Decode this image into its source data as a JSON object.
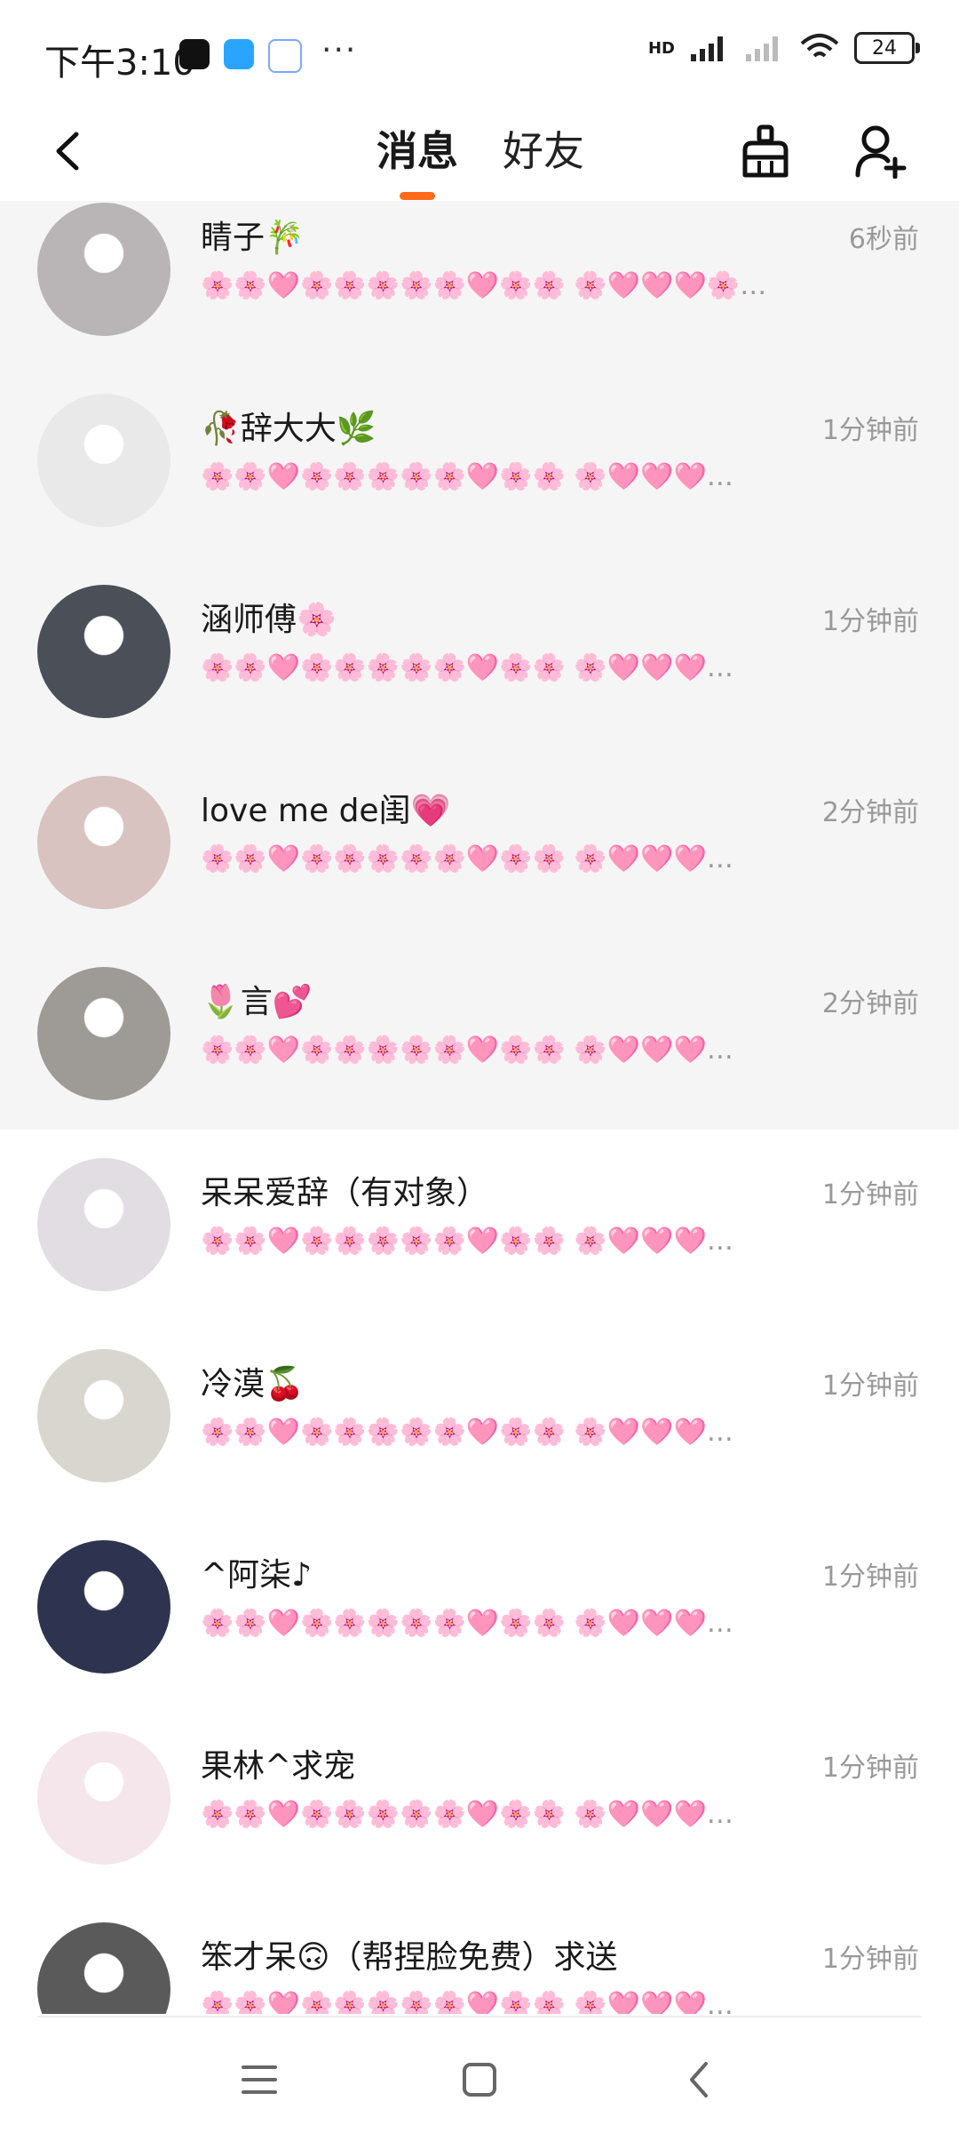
{
  "status_bar": {
    "time": "下午3:10",
    "more_dots": "···",
    "network_label": "HD",
    "battery": "24"
  },
  "nav": {
    "tab_messages": "消息",
    "tab_friends": "好友",
    "accent": "#ff6a1a"
  },
  "messages": [
    {
      "name": "睛子🎋",
      "time": "6秒前",
      "preview": "🌸🌸🩷🌸🌸🌸🌸🌸🩷🌸🌸 🌸🩷🩷🩷🌸…",
      "pinned": true,
      "avatar_color": "#b9b4b6"
    },
    {
      "name": "🥀辞大大🌿",
      "time": "1分钟前",
      "preview": "🌸🌸🩷🌸🌸🌸🌸🌸🩷🌸🌸 🌸🩷🩷🩷…",
      "pinned": true,
      "avatar_color": "#e9e9e9"
    },
    {
      "name": "涵师傅🌸",
      "time": "1分钟前",
      "preview": "🌸🌸🩷🌸🌸🌸🌸🌸🩷🌸🌸 🌸🩷🩷🩷…",
      "pinned": true,
      "avatar_color": "#4b4f57"
    },
    {
      "name": "love me de闺💗",
      "time": "2分钟前",
      "preview": "🌸🌸🩷🌸🌸🌸🌸🌸🩷🌸🌸 🌸🩷🩷🩷…",
      "pinned": true,
      "avatar_color": "#d8c3c0"
    },
    {
      "name": "🌷言💕",
      "time": "2分钟前",
      "preview": "🌸🌸🩷🌸🌸🌸🌸🌸🩷🌸🌸 🌸🩷🩷🩷…",
      "pinned": true,
      "avatar_color": "#9e9a96"
    },
    {
      "name": "呆呆爱辞（有对象）",
      "time": "1分钟前",
      "preview": "🌸🌸🩷🌸🌸🌸🌸🌸🩷🌸🌸 🌸🩷🩷🩷…",
      "pinned": false,
      "avatar_color": "#e2dde3"
    },
    {
      "name": "冷漠🍒",
      "time": "1分钟前",
      "preview": "🌸🌸🩷🌸🌸🌸🌸🌸🩷🌸🌸 🌸🩷🩷🩷…",
      "pinned": false,
      "avatar_color": "#d9d6d0"
    },
    {
      "name": "^阿柒♪",
      "time": "1分钟前",
      "preview": "🌸🌸🩷🌸🌸🌸🌸🌸🩷🌸🌸 🌸🩷🩷🩷…",
      "pinned": false,
      "avatar_color": "#2e3350"
    },
    {
      "name": "果林^求宠",
      "time": "1分钟前",
      "preview": "🌸🌸🩷🌸🌸🌸🌸🌸🩷🌸🌸 🌸🩷🩷🩷…",
      "pinned": false,
      "avatar_color": "#f4e6ea"
    },
    {
      "name": "笨才呆🙃（帮捏脸免费）求送",
      "time": "1分钟前",
      "preview": "🌸🌸🩷🌸🌸🌸🌸🌸🩷🌸🌸 🌸🩷🩷🩷…",
      "pinned": false,
      "avatar_color": "#5a5a5a"
    }
  ]
}
